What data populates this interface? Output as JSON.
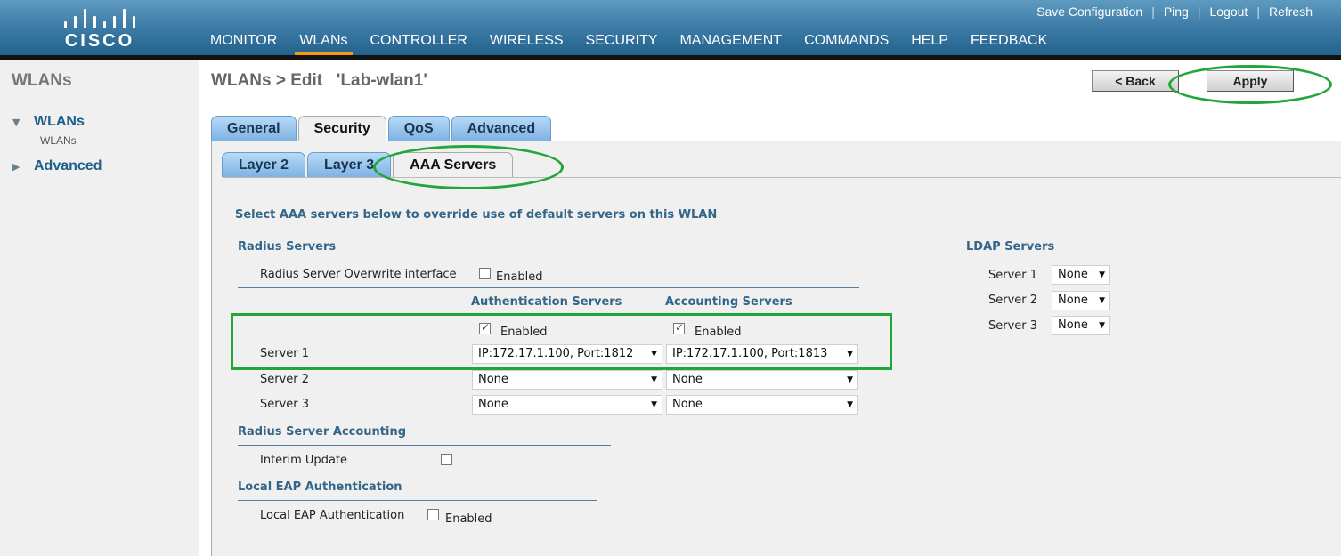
{
  "brand": {
    "logo_text": "CISCO"
  },
  "utility_links": [
    "Save Configuration",
    "Ping",
    "Logout",
    "Refresh"
  ],
  "main_nav": {
    "items": [
      "MONITOR",
      "WLANs",
      "CONTROLLER",
      "WIRELESS",
      "SECURITY",
      "MANAGEMENT",
      "COMMANDS",
      "HELP",
      "FEEDBACK"
    ],
    "active": "WLANs"
  },
  "sidebar": {
    "title": "WLANs",
    "items": [
      {
        "label": "WLANs",
        "expanded": true,
        "sub": "WLANs"
      },
      {
        "label": "Advanced",
        "expanded": false
      }
    ]
  },
  "page": {
    "title": "WLANs > Edit   'Lab-wlan1'",
    "back_label": "< Back",
    "apply_label": "Apply"
  },
  "tabs": {
    "primary": [
      "General",
      "Security",
      "QoS",
      "Advanced"
    ],
    "primary_active": "Security",
    "secondary": [
      "Layer 2",
      "Layer 3",
      "AAA Servers"
    ],
    "secondary_active": "AAA Servers"
  },
  "aaa": {
    "intro": "Select AAA servers below to override use of default servers on this WLAN",
    "radius": {
      "heading": "Radius Servers",
      "overwrite_label": "Radius Server Overwrite interface",
      "overwrite_enabled_label": "Enabled",
      "overwrite_checked": false,
      "auth_heading": "Authentication Servers",
      "acct_heading": "Accounting Servers",
      "auth_enabled_label": "Enabled",
      "auth_checked": true,
      "acct_enabled_label": "Enabled",
      "acct_checked": true,
      "servers": [
        {
          "label": "Server 1",
          "auth": "IP:172.17.1.100, Port:1812",
          "acct": "IP:172.17.1.100, Port:1813"
        },
        {
          "label": "Server 2",
          "auth": "None",
          "acct": "None"
        },
        {
          "label": "Server 3",
          "auth": "None",
          "acct": "None"
        }
      ]
    },
    "radius_accounting": {
      "heading": "Radius Server Accounting",
      "interim_label": "Interim Update",
      "interim_checked": false
    },
    "local_eap": {
      "heading": "Local EAP Authentication",
      "label": "Local EAP Authentication",
      "enabled_label": "Enabled",
      "checked": false
    },
    "ldap": {
      "heading": "LDAP Servers",
      "servers": [
        {
          "label": "Server 1",
          "value": "None"
        },
        {
          "label": "Server 2",
          "value": "None"
        },
        {
          "label": "Server 3",
          "value": "None"
        }
      ]
    }
  },
  "colors": {
    "header_top": "#5f9bc0",
    "header_bottom": "#24628e",
    "nav_active_underline": "#f39c12",
    "tab_blue": "#7fb2e3",
    "annotation_green": "#22a63a",
    "section_heading": "#336688"
  }
}
